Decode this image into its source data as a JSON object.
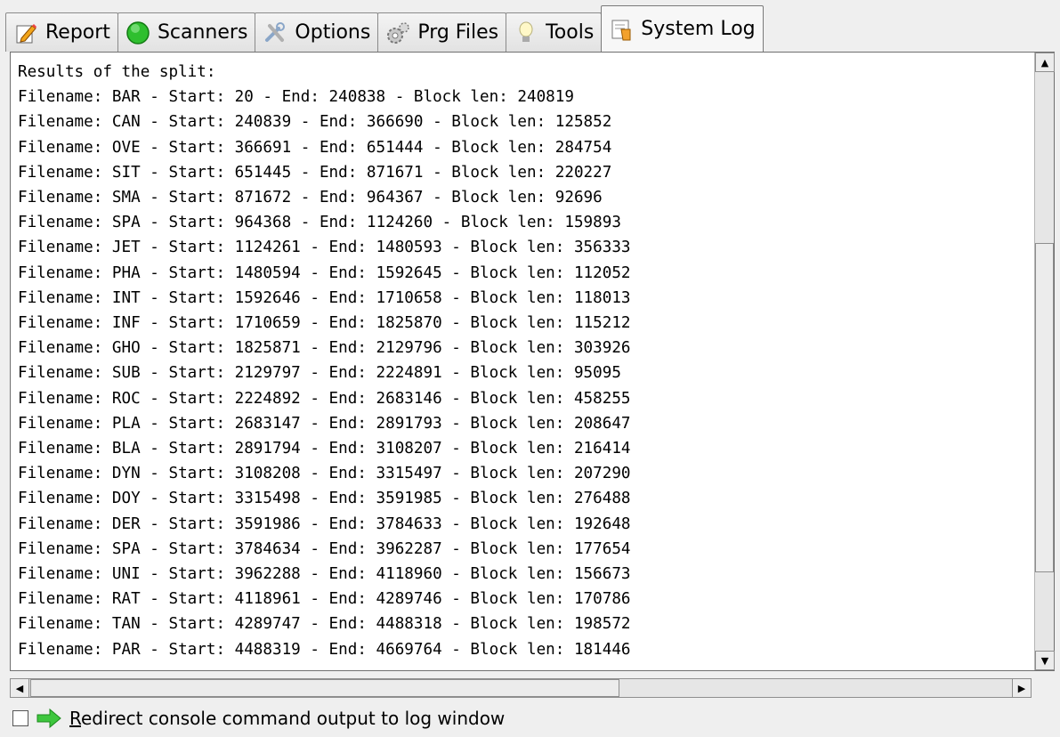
{
  "tabs": [
    {
      "label": "Report",
      "icon": "pencil-report-icon"
    },
    {
      "label": "Scanners",
      "icon": "green-circle-icon"
    },
    {
      "label": "Options",
      "icon": "tools-options-icon"
    },
    {
      "label": "Prg Files",
      "icon": "gears-icon"
    },
    {
      "label": "Tools",
      "icon": "lightbulb-icon"
    },
    {
      "label": "System Log",
      "icon": "log-icon",
      "active": true
    }
  ],
  "log": {
    "lines": [
      "Results of the split:",
      "Filename: BAR - Start: 20 - End: 240838 - Block len: 240819",
      "Filename: CAN - Start: 240839 - End: 366690 - Block len: 125852",
      "Filename: OVE - Start: 366691 - End: 651444 - Block len: 284754",
      "Filename: SIT - Start: 651445 - End: 871671 - Block len: 220227",
      "Filename: SMA - Start: 871672 - End: 964367 - Block len: 92696",
      "Filename: SPA - Start: 964368 - End: 1124260 - Block len: 159893",
      "Filename: JET - Start: 1124261 - End: 1480593 - Block len: 356333",
      "Filename: PHA - Start: 1480594 - End: 1592645 - Block len: 112052",
      "Filename: INT - Start: 1592646 - End: 1710658 - Block len: 118013",
      "Filename: INF - Start: 1710659 - End: 1825870 - Block len: 115212",
      "Filename: GHO - Start: 1825871 - End: 2129796 - Block len: 303926",
      "Filename: SUB - Start: 2129797 - End: 2224891 - Block len: 95095",
      "Filename: ROC - Start: 2224892 - End: 2683146 - Block len: 458255",
      "Filename: PLA - Start: 2683147 - End: 2891793 - Block len: 208647",
      "Filename: BLA - Start: 2891794 - End: 3108207 - Block len: 216414",
      "Filename: DYN - Start: 3108208 - End: 3315497 - Block len: 207290",
      "Filename: DOY - Start: 3315498 - End: 3591985 - Block len: 276488",
      "Filename: DER - Start: 3591986 - End: 3784633 - Block len: 192648",
      "Filename: SPA - Start: 3784634 - End: 3962287 - Block len: 177654",
      "Filename: UNI - Start: 3962288 - End: 4118960 - Block len: 156673",
      "Filename: RAT - Start: 4118961 - End: 4289746 - Block len: 170786",
      "Filename: TAN - Start: 4289747 - End: 4488318 - Block len: 198572",
      "Filename: PAR - Start: 4488319 - End: 4669764 - Block len: 181446"
    ]
  },
  "footer": {
    "checkbox_checked": false,
    "redirect_label": "Redirect console command output to log window"
  }
}
